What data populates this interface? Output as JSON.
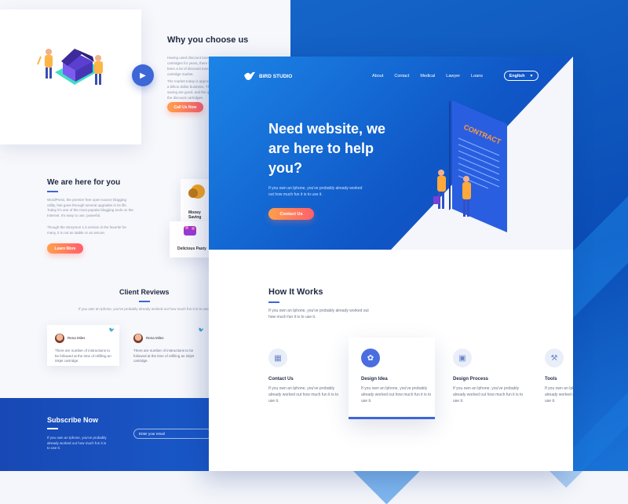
{
  "back": {
    "why": {
      "title": "Why you choose us",
      "text1": "Having used discount toner cartridges for years, there have been a lot of discount toner cartridge market.",
      "text2": "The market today is approximately a billion dollar business. The saving are good, and the quality of the discount cartridges.",
      "button": "Call Us Now"
    },
    "here": {
      "title": "We are here for you",
      "text1": "WordPress, the premier free open-source blogging utility, has gone through several upgrades in its life. Today it's one of the most popular blogging tools on the Internet. It's easy to use, powerful.",
      "text2": "Though the Storymon 1.5 version is the favorite for many, it is not as stable or as secure.",
      "button": "Learn More",
      "food": [
        "Money Saving",
        "Delicious Pasty"
      ]
    },
    "reviews": {
      "title": "Client Reviews",
      "subtitle": "If you own an Iphone, you've probably already worked out how much fun it is to use it.",
      "items": [
        {
          "name": "Rena Miles",
          "role": "Nowell",
          "text": "There are number of instructions to be followed at the time of refilling an inkjet cartridge."
        },
        {
          "name": "Rena Miles",
          "role": "Nowell",
          "text": "There are number of instructions to be followed at the time of refilling an inkjet cartridge."
        }
      ]
    },
    "subscribe": {
      "title": "Subscribe Now",
      "text": "If you own an Iphone, you've probably already worked out how much fun it is to use it.",
      "placeholder": "Enter your email"
    }
  },
  "front": {
    "logo": "BIRD STUDIO",
    "nav": [
      "About",
      "Contact",
      "Medical",
      "Lawyer",
      "Loans"
    ],
    "language": "English",
    "hero": {
      "title": "Need website, we are here to help you?",
      "subtitle": "If you own an Iphone, you've probably already worked out how much fun it is to use it.",
      "button": "Contact Us",
      "illustration_label": "CONTRACT"
    },
    "how": {
      "title": "How It Works",
      "subtitle": "If you own an Iphone, you've probably already worked out how much fun it is to use it.",
      "steps": [
        {
          "title": "Contact Us",
          "text": "If you own an Iphone, you've probably already worked out how much fun it is to use it.",
          "icon": "contact-icon"
        },
        {
          "title": "Design Idea",
          "text": "If you own an Iphone, you've probably already worked out how much fun it is to use it.",
          "icon": "design-idea-icon"
        },
        {
          "title": "Design Process",
          "text": "If you own an Iphone, you've probably already worked out how much fun it is to use it.",
          "icon": "design-process-icon"
        },
        {
          "title": "Tools",
          "text": "If you own an Iphone, you've probably already worked out how much fun it is to use it.",
          "icon": "tools-icon"
        }
      ]
    }
  },
  "colors": {
    "primary": "#1a6fdc",
    "accent_start": "#ff9f4a",
    "accent_end": "#ff5f6d"
  }
}
